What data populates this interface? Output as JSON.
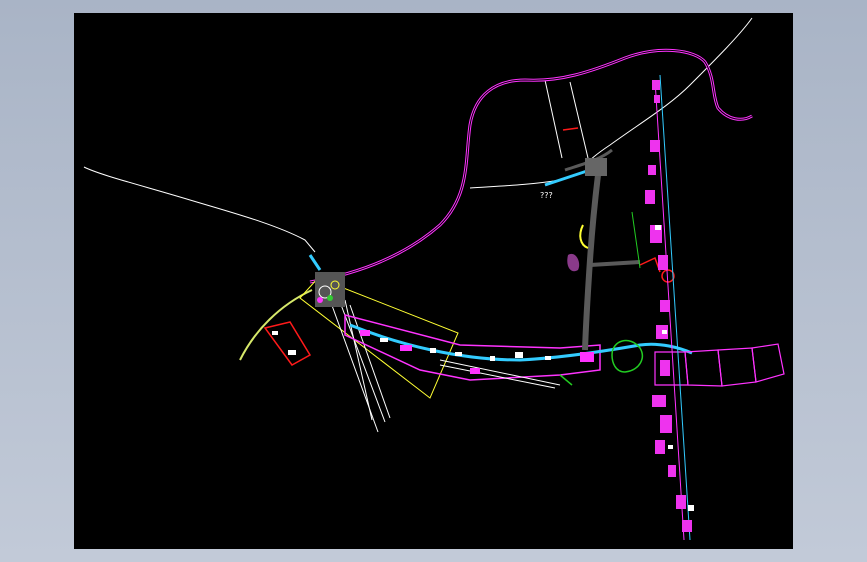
{
  "canvas": {
    "background": "#000000",
    "frame": "#b4bdcd"
  },
  "colors": {
    "road": "#ff33ff",
    "track": "#ffffff",
    "cyan": "#33ccff",
    "yellow": "#ffff33",
    "red": "#ff1a1a",
    "green": "#22cc22",
    "gray": "#5a5a5a",
    "sites": "#ee33ee"
  },
  "labels": {
    "junction_marks": "???"
  }
}
